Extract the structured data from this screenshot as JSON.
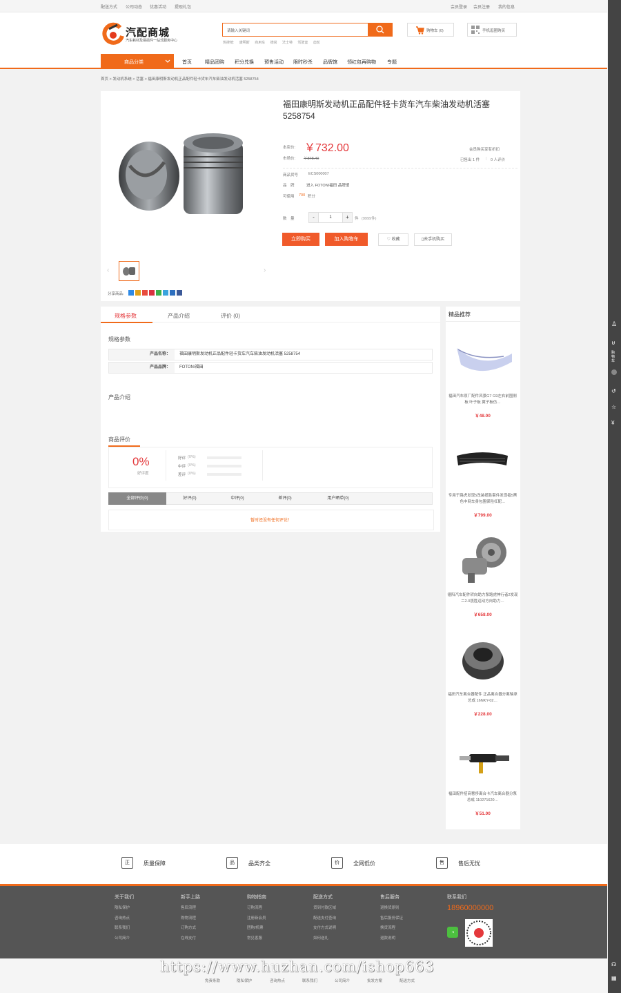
{
  "topbar": {
    "left": [
      "配送方式",
      "公司动态",
      "优惠活动",
      "提现礼包"
    ],
    "right": [
      "会员登录",
      "会员注册",
      "我的信息"
    ]
  },
  "header": {
    "logo_title": "汽配商城",
    "logo_sub": "汽车耗材及易损件一站式服务中心",
    "search_placeholder": "请输入关键词",
    "hotwords_label": "热搜榜:",
    "hotwords": [
      "康明斯",
      "商用车",
      "德尚",
      "法士特",
      "驾驶室",
      "齿轮"
    ],
    "cart_label": "购物车 (0)",
    "mobile_label": "手机逛圈购买"
  },
  "nav": {
    "category_label": "商品分类",
    "items": [
      "首页",
      "精品团购",
      "积分兑换",
      "预售活动",
      "限时秒杀",
      "品牌馆",
      "领红包再购物",
      "专题"
    ]
  },
  "breadcrumb": "首页 > 发动机系统 > 活塞 > 福田康明斯发动机正品配件轻卡货车汽车柴油发动机活塞 5258754",
  "product": {
    "title": "福田康明斯发动机正品配件轻卡货车汽车柴油发动机活塞 5258754",
    "price_label": "本店价:",
    "price": "￥732.00",
    "market_label": "市场价:",
    "market_price": "￥878.40",
    "member_price_label": "会员购买享有折扣",
    "sold_count": "已售出 1 件",
    "reviews_count": "0 人评价",
    "sku_label": "商品货号",
    "sku": "ECS000007",
    "brand_label": "品　牌",
    "brand": "进入 FOTON/福田 品牌馆",
    "points_label": "可使用",
    "points": "700",
    "points_unit": "积分",
    "qty_label": "数　量",
    "qty": "1",
    "qty_unit": "件",
    "stock": "(9999件)",
    "buy_now": "立即购买",
    "add_cart": "加入购物车",
    "favorite": "收藏",
    "mobile_buy": "去手机购买",
    "share_label": "分享商品:"
  },
  "tabs": [
    "规格参数",
    "产品介绍",
    "评价 (0)"
  ],
  "specs": {
    "heading": "规格参数",
    "rows": [
      {
        "key": "产品名称：",
        "value": "福田康明斯发动机正品配件轻卡货车汽车柴油发动机活塞 5258754"
      },
      {
        "key": "产品品牌：",
        "value": "FOTON/福田"
      }
    ]
  },
  "intro_heading": "产品介绍",
  "reviews": {
    "heading": "商品评价",
    "rate": "0%",
    "rate_label": "好评度",
    "bars": [
      {
        "label": "好评",
        "pct": "(0%)",
        "fill": 0
      },
      {
        "label": "中评",
        "pct": "(0%)",
        "fill": 0
      },
      {
        "label": "差评",
        "pct": "(0%)",
        "fill": 0
      }
    ],
    "tabs": [
      "全部评价(0)",
      "好评(0)",
      "中评(0)",
      "差评(0)",
      "用户晒单(0)"
    ],
    "empty": "暂时还没有任何评论！"
  },
  "recommend": {
    "title": "精品推荐",
    "items": [
      {
        "name": "福田汽车原厂配件风景G7 G9左右前围侧板 叶子板 翼子板仿…",
        "price": "￥48.00"
      },
      {
        "name": "专用于路虎发现5改装揽胜套件发现者5黑色中网车身包围保险杠配…",
        "price": "￥799.00"
      },
      {
        "name": "德阳汽车配件转向助力泵路虎神行者2发现二2.0揽胜运动方向助力…",
        "price": "￥658.00"
      },
      {
        "name": "福田汽车离合器配件 正品离合器分离轴承总成 16NKY-02…",
        "price": "￥228.00"
      },
      {
        "name": "福田配件招商奢侈离合卡汽车离合器分泵总成 110271620…",
        "price": "￥51.00"
      }
    ]
  },
  "guarantees": [
    {
      "icon": "正",
      "label": "质量保障"
    },
    {
      "icon": "品",
      "label": "品类齐全"
    },
    {
      "icon": "价",
      "label": "全网低价"
    },
    {
      "icon": "售",
      "label": "售后无忧"
    }
  ],
  "footer": {
    "cols": [
      {
        "title": "关于我们",
        "links": [
          "隐私保护",
          "咨询热点",
          "联系我们",
          "公司简介"
        ]
      },
      {
        "title": "新手上路",
        "links": [
          "售后流程",
          "购物流程",
          "订购方式",
          "在线支付"
        ]
      },
      {
        "title": "购物指南",
        "links": [
          "订购流程",
          "注册新会员",
          "团购/机票",
          "常见客服"
        ]
      },
      {
        "title": "配送方式",
        "links": [
          "货到付款区域",
          "配送支付查询",
          "支付方式说明",
          "如何送礼"
        ]
      },
      {
        "title": "售后服务",
        "links": [
          "退换货原则",
          "售后服务保证",
          "换货流程",
          "退款说明"
        ]
      }
    ],
    "contact_title": "联系我们",
    "phone": "18960000000",
    "bottom_links": [
      "免责条款",
      "隐私保护",
      "咨询热点",
      "联系我们",
      "公司简介",
      "批发方案",
      "配送方式"
    ],
    "watermark": "https://www.huzhan.com/ishop663"
  },
  "colors": {
    "accent": "#f06a1a",
    "price": "#e4393c"
  }
}
